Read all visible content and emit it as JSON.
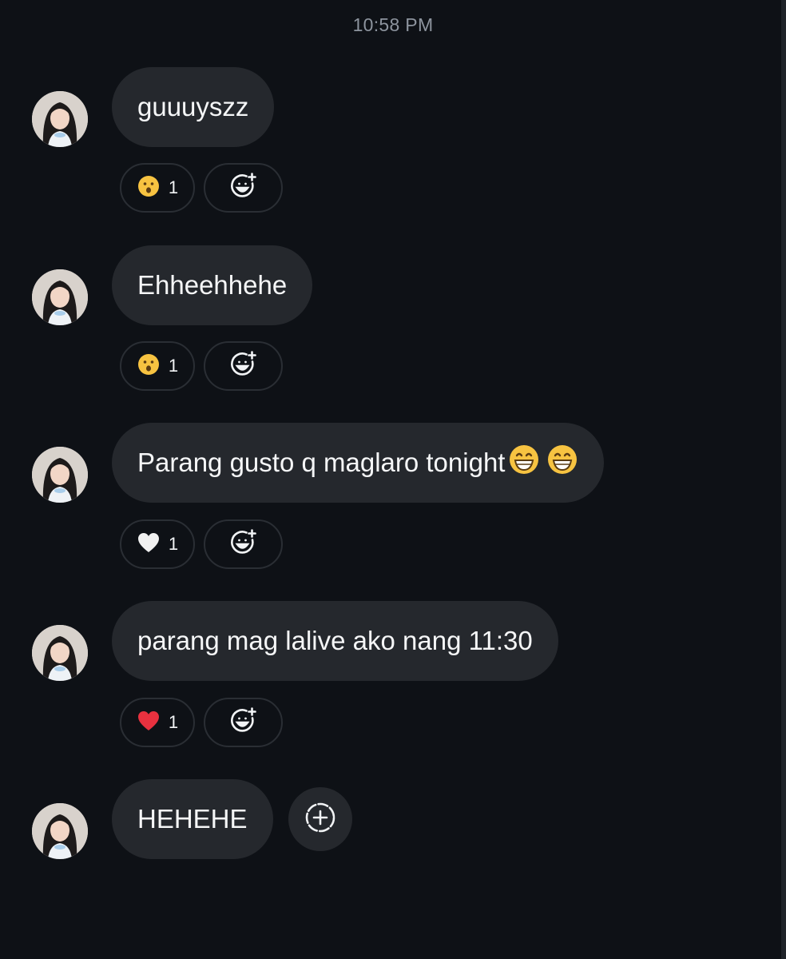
{
  "timestamp": "10:58 PM",
  "messages": [
    {
      "text": "guuuyszz",
      "reaction": {
        "emoji": "😮",
        "icon": "hushed-face-icon",
        "count": "1"
      }
    },
    {
      "text": "Ehheehhehe",
      "reaction": {
        "emoji": "😮",
        "icon": "hushed-face-icon",
        "count": "1"
      }
    },
    {
      "text": "Parang gusto q maglaro tonight",
      "trailing_emoji": [
        "😁",
        "😁"
      ],
      "reaction": {
        "emoji": "🤍",
        "icon": "white-heart-icon",
        "count": "1"
      }
    },
    {
      "text": "parang mag lalive ako nang 11:30",
      "reaction": {
        "emoji": "❤️",
        "icon": "red-heart-icon",
        "count": "1"
      }
    },
    {
      "text": "HEHEHE"
    }
  ],
  "colors": {
    "background": "#0e1116",
    "bubble": "#25282d",
    "chip_border": "#2a2e34",
    "timestamp": "#8d949e",
    "text": "#f5f6f7"
  }
}
